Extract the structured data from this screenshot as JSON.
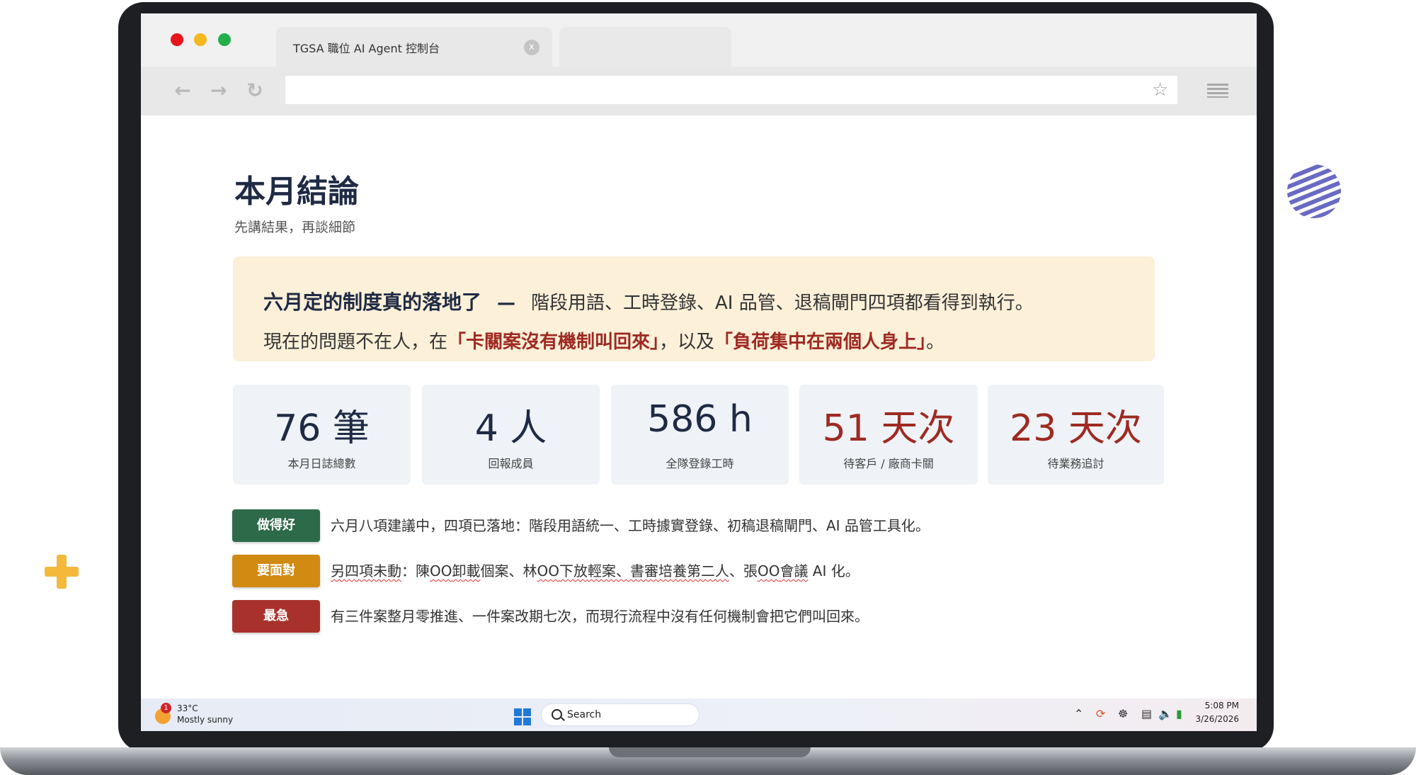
{
  "browser": {
    "tab_title": "TGSA 職位 AI Agent 控制台",
    "tab_close": "x",
    "address": "",
    "traffic_lights": [
      "#e8141c",
      "#f3b81b",
      "#23b04b"
    ]
  },
  "page": {
    "title": "本月結論",
    "subtitle": "先講結果，再談細節"
  },
  "summary": {
    "headline": "六月定的制度真的落地了",
    "dash": "—",
    "line1_rest": "階段用語、工時登錄、AI 品管、退稿閘門四項都看得到執行。",
    "line2_prefix": "現在的問題不在人，在",
    "line2_highlight1": "「卡關案沒有機制叫回來」",
    "line2_mid": "，以及",
    "line2_highlight2": "「負荷集中在兩個人身上」",
    "line2_suffix": "。"
  },
  "stats": [
    {
      "value": "76 筆",
      "label": "本月日誌總數",
      "alert": false
    },
    {
      "value": "4 人",
      "label": "回報成員",
      "alert": false
    },
    {
      "value": "586 h",
      "label": "全隊登錄工時",
      "alert": false
    },
    {
      "value": "51 天次",
      "label": "待客戶 / 廠商卡關",
      "alert": true
    },
    {
      "value": "23 天次",
      "label": "待業務追討",
      "alert": true
    }
  ],
  "items": [
    {
      "tag": "做得好",
      "color": "#2d6a4a",
      "text": "六月八項建議中，四項已落地：階段用語統一、工時據實登錄、初稿退稿閘門、AI 品管工具化。"
    },
    {
      "tag": "要面對",
      "color": "#d18a12",
      "text_parts": [
        "另四項未動",
        "：陳",
        "OO",
        "卸載",
        "個案、林",
        "OO",
        "下放",
        "輕案、書審培養第二人",
        "、張",
        "OO",
        "會議",
        " AI 化。"
      ]
    },
    {
      "tag": "最急",
      "color": "#a8322b",
      "text": "有三件案整月零推進、一件案改期七次，而現行流程中沒有任何機制會把它們叫回來。"
    }
  ],
  "taskbar": {
    "weather_badge": "1",
    "weather_temp": "33°C",
    "weather_desc": "Mostly sunny",
    "search_label": "Search",
    "time": "5:08 PM",
    "date": "3/26/2026"
  }
}
